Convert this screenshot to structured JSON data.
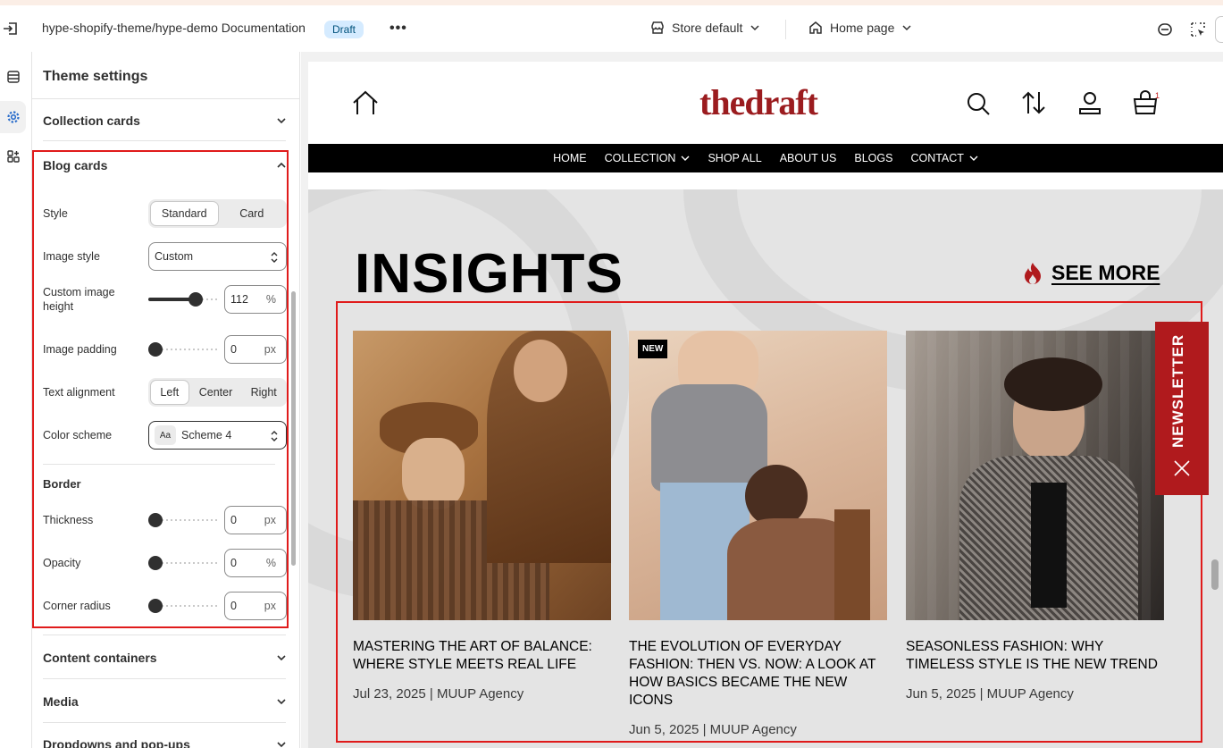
{
  "topbar": {
    "title": "hype-shopify-theme/hype-demo Documentation",
    "badge": "Draft",
    "more": "•••",
    "store": "Store default",
    "page": "Home page"
  },
  "panel": {
    "title": "Theme settings",
    "collection_cards": "Collection cards",
    "blog_cards": "Blog cards",
    "content_containers": "Content containers",
    "media": "Media",
    "dropdowns": "Dropdowns and pop-ups"
  },
  "blog": {
    "style_label": "Style",
    "style_options": [
      "Standard",
      "Card"
    ],
    "style_selected": "Standard",
    "image_style_label": "Image style",
    "image_style_value": "Custom",
    "custom_height_label": "Custom image height",
    "custom_height_value": "112",
    "custom_height_unit": "%",
    "custom_height_fraction": 0.72,
    "image_padding_label": "Image padding",
    "image_padding_value": "0",
    "image_padding_unit": "px",
    "text_alignment_label": "Text alignment",
    "text_alignment_options": [
      "Left",
      "Center",
      "Right"
    ],
    "text_alignment_selected": "Left",
    "color_scheme_label": "Color scheme",
    "color_scheme_value": "Scheme 4",
    "color_scheme_icon": "Aa",
    "border_heading": "Border",
    "thickness_label": "Thickness",
    "thickness_value": "0",
    "thickness_unit": "px",
    "opacity_label": "Opacity",
    "opacity_value": "0",
    "opacity_unit": "%",
    "radius_label": "Corner radius",
    "radius_value": "0",
    "radius_unit": "px"
  },
  "site": {
    "logo": "thedraft",
    "cart_count": "1",
    "nav": [
      "HOME",
      "COLLECTION",
      "SHOP ALL",
      "ABOUT US",
      "BLOGS",
      "CONTACT"
    ],
    "heading": "INSIGHTS",
    "see_more": "SEE MORE",
    "newsletter": "NEWSLETTER",
    "cards": [
      {
        "title": "MASTERING THE ART OF BALANCE: WHERE STYLE MEETS REAL LIFE",
        "meta": "Jul 23, 2025  |  MUUP Agency",
        "badge": ""
      },
      {
        "title": "THE EVOLUTION OF EVERYDAY FASHION: THEN VS. NOW: A LOOK AT HOW BASICS BECAME THE NEW ICONS",
        "meta": "Jun 5, 2025  |  MUUP Agency",
        "badge": "NEW"
      },
      {
        "title": "SEASONLESS FASHION: WHY TIMELESS STYLE IS THE NEW TREND",
        "meta": "Jun 5, 2025  |  MUUP Agency",
        "badge": ""
      }
    ]
  },
  "colors": {
    "accent_red": "#e01b1b",
    "brand_red": "#9b1c1f",
    "badge_bg": "#d5ebff",
    "nav_bg": "#000000"
  }
}
